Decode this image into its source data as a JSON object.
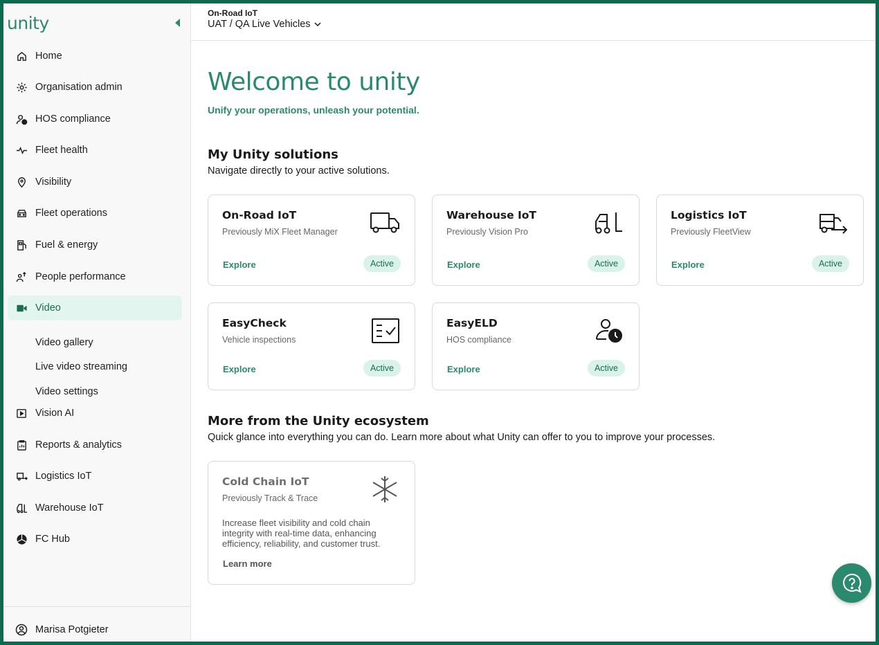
{
  "brand": {
    "logo_text": "unity",
    "accent": "#2b8a6e",
    "active_bg": "#e3f5ef"
  },
  "header": {
    "context_title": "On-Road IoT",
    "context_selector": "UAT / QA Live Vehicles"
  },
  "sidebar": {
    "items": [
      {
        "label": "Home",
        "icon": "home-icon"
      },
      {
        "label": "Organisation admin",
        "icon": "gear-icon"
      },
      {
        "label": "HOS compliance",
        "icon": "person-clock-icon"
      },
      {
        "label": "Fleet health",
        "icon": "pulse-icon"
      },
      {
        "label": "Visibility",
        "icon": "location-pin-icon"
      },
      {
        "label": "Fleet operations",
        "icon": "car-icon"
      },
      {
        "label": "Fuel & energy",
        "icon": "fuel-icon"
      },
      {
        "label": "People performance",
        "icon": "people-icon"
      },
      {
        "label": "Video",
        "icon": "video-camera-icon",
        "active": true
      },
      {
        "label": "Vision AI",
        "icon": "vision-play-icon"
      },
      {
        "label": "Reports & analytics",
        "icon": "clipboard-icon"
      },
      {
        "label": "Logistics IoT",
        "icon": "truck-arrow-icon"
      },
      {
        "label": "Warehouse IoT",
        "icon": "forklift-icon"
      },
      {
        "label": "FC Hub",
        "icon": "hub-icon"
      }
    ],
    "video_sub": [
      "Video gallery",
      "Live video streaming",
      "Video settings"
    ],
    "user": "Marisa Potgieter"
  },
  "main": {
    "welcome": "Welcome to unity",
    "tagline": "Unify your operations, unleash your potential.",
    "solutions": {
      "title": "My Unity solutions",
      "subtitle": "Navigate directly to your active solutions.",
      "cards": [
        {
          "title": "On-Road IoT",
          "subtitle": "Previously MiX Fleet Manager",
          "explore": "Explore",
          "status": "Active",
          "icon": "truck-icon"
        },
        {
          "title": "Warehouse IoT",
          "subtitle": "Previously Vision Pro",
          "explore": "Explore",
          "status": "Active",
          "icon": "forklift-icon"
        },
        {
          "title": "Logistics IoT",
          "subtitle": "Previously FleetView",
          "explore": "Explore",
          "status": "Active",
          "icon": "truck-arrow-icon"
        },
        {
          "title": "EasyCheck",
          "subtitle": "Vehicle inspections",
          "explore": "Explore",
          "status": "Active",
          "icon": "checklist-icon"
        },
        {
          "title": "EasyELD",
          "subtitle": "HOS compliance",
          "explore": "Explore",
          "status": "Active",
          "icon": "person-clock-icon"
        }
      ]
    },
    "ecosystem": {
      "title": "More from the Unity ecosystem",
      "subtitle": "Quick glance into everything you can do. Learn more about what Unity can offer to you to improve your processes.",
      "cards": [
        {
          "title": "Cold Chain IoT",
          "subtitle": "Previously Track & Trace",
          "description": "Increase fleet visibility and cold chain integrity with real-time data, enhancing efficiency, reliability, and customer trust.",
          "link": "Learn more",
          "icon": "snowflake-icon"
        }
      ]
    }
  },
  "help": {
    "icon": "help-chat-icon"
  }
}
